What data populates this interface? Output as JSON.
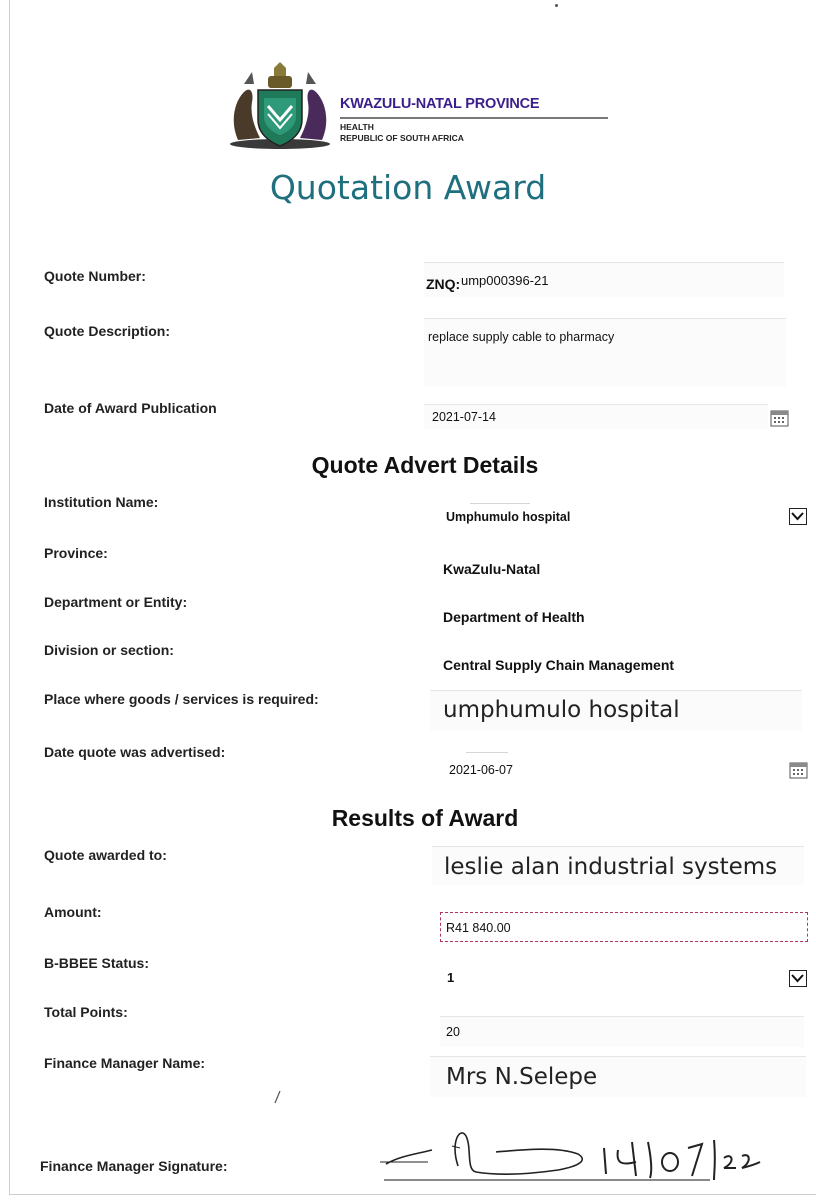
{
  "header": {
    "province": "KWAZULU-NATAL PROVINCE",
    "department": "HEALTH",
    "country": "REPUBLIC OF SOUTH AFRICA",
    "title": "Quotation Award"
  },
  "quote": {
    "number_label": "Quote Number:",
    "number_prefix": "ZNQ:",
    "number_value": "ump000396-21",
    "description_label": "Quote Description:",
    "description_value": "replace supply cable to pharmacy",
    "award_date_label": "Date of Award Publication",
    "award_date_value": "2021-07-14"
  },
  "advert": {
    "section_title": "Quote Advert Details",
    "institution_label": "Institution Name:",
    "institution_value": "Umphumulo hospital",
    "province_label": "Province:",
    "province_value": "KwaZulu-Natal",
    "department_label": "Department or Entity:",
    "department_value": "Department of Health",
    "division_label": "Division or section:",
    "division_value": "Central Supply Chain Management",
    "place_label": "Place where goods /  services is required:",
    "place_value": "umphumulo hospital",
    "advertised_label": "Date quote was advertised:",
    "advertised_value": "2021-06-07"
  },
  "results": {
    "section_title": "Results of Award",
    "awarded_to_label": "Quote awarded to:",
    "awarded_to_value": "leslie alan industrial systems",
    "amount_label": "Amount:",
    "amount_value": "R41 840.00",
    "bbbee_label": "B-BBEE Status:",
    "bbbee_value": "1",
    "points_label": "Total Points:",
    "points_value": "20",
    "manager_label": "Finance Manager Name:",
    "manager_value": "Mrs N.Selepe",
    "signature_label": "Finance Manager Signature:"
  },
  "icons": {
    "crest": "kzn-coat-of-arms-icon",
    "calendar": "calendar-icon",
    "dropdown": "chevron-down-icon"
  },
  "colors": {
    "title": "#1f6f7e",
    "province": "#3a1f8a",
    "amount_border": "#b0365a"
  }
}
